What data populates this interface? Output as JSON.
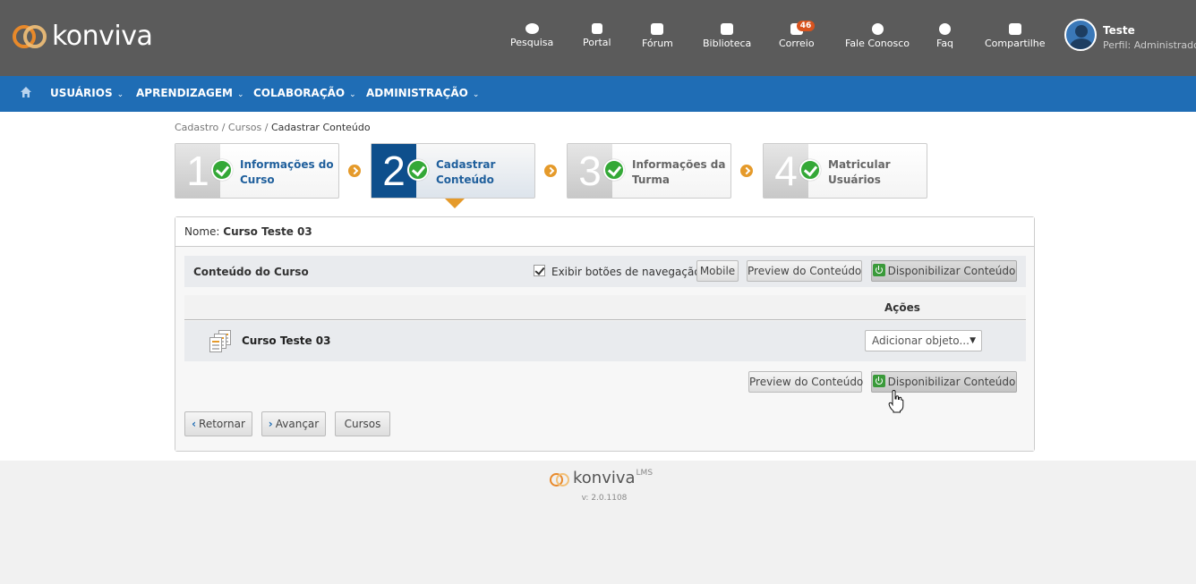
{
  "brand": {
    "name": "konviva",
    "footer_name": "konviva",
    "footer_sup": "LMS",
    "version": "v: 2.0.1108"
  },
  "topnav": [
    {
      "label": "Pesquisa",
      "icon": "chat-icon"
    },
    {
      "label": "Portal",
      "icon": "external-link-icon"
    },
    {
      "label": "Fórum",
      "icon": "comment-icon"
    },
    {
      "label": "Biblioteca",
      "icon": "folder-icon"
    },
    {
      "label": "Correio",
      "icon": "mail-icon",
      "badge": "46"
    },
    {
      "label": "Fale Conosco",
      "icon": "headset-icon"
    },
    {
      "label": "Faq",
      "icon": "question-icon"
    },
    {
      "label": "Compartilhe",
      "icon": "share-icon"
    }
  ],
  "user": {
    "name": "Teste",
    "profile": "Perfil: Administrador"
  },
  "menu": [
    {
      "label": "USUÁRIOS"
    },
    {
      "label": "APRENDIZAGEM"
    },
    {
      "label": "COLABORAÇÃO"
    },
    {
      "label": "ADMINISTRAÇÃO"
    }
  ],
  "breadcrumb": {
    "items": [
      "Cadastro",
      "Cursos"
    ],
    "current": "Cadastrar Conteúdo",
    "sep": " / "
  },
  "steps": [
    {
      "number": "1",
      "label": "Informações do Curso",
      "state": "done"
    },
    {
      "number": "2",
      "label": "Cadastrar Conteúdo",
      "state": "active"
    },
    {
      "number": "3",
      "label": "Informações da Turma",
      "state": "done"
    },
    {
      "number": "4",
      "label": "Matricular Usuários",
      "state": "done"
    }
  ],
  "panel": {
    "name_label": "Nome:",
    "name_value": "Curso Teste 03",
    "section_title": "Conteúdo do Curso",
    "show_nav_label": "Exibir botões de navegação",
    "show_nav_checked": true,
    "btn_mobile": "Mobile",
    "btn_preview": "Preview do Conteúdo",
    "btn_publish": "Disponibilizar Conteúdo",
    "col_actions": "Ações",
    "rows": [
      {
        "name": "Curso Teste 03",
        "action_select": "Adicionar objeto..."
      }
    ],
    "btn_back": "Retornar",
    "btn_next": "Avançar",
    "btn_courses": "Cursos"
  },
  "colors": {
    "topbar": "#5b5b5b",
    "nav": "#1f6db5",
    "accent": "#e59a2a",
    "active_step": "#0e4f8c",
    "check": "#34a837"
  }
}
